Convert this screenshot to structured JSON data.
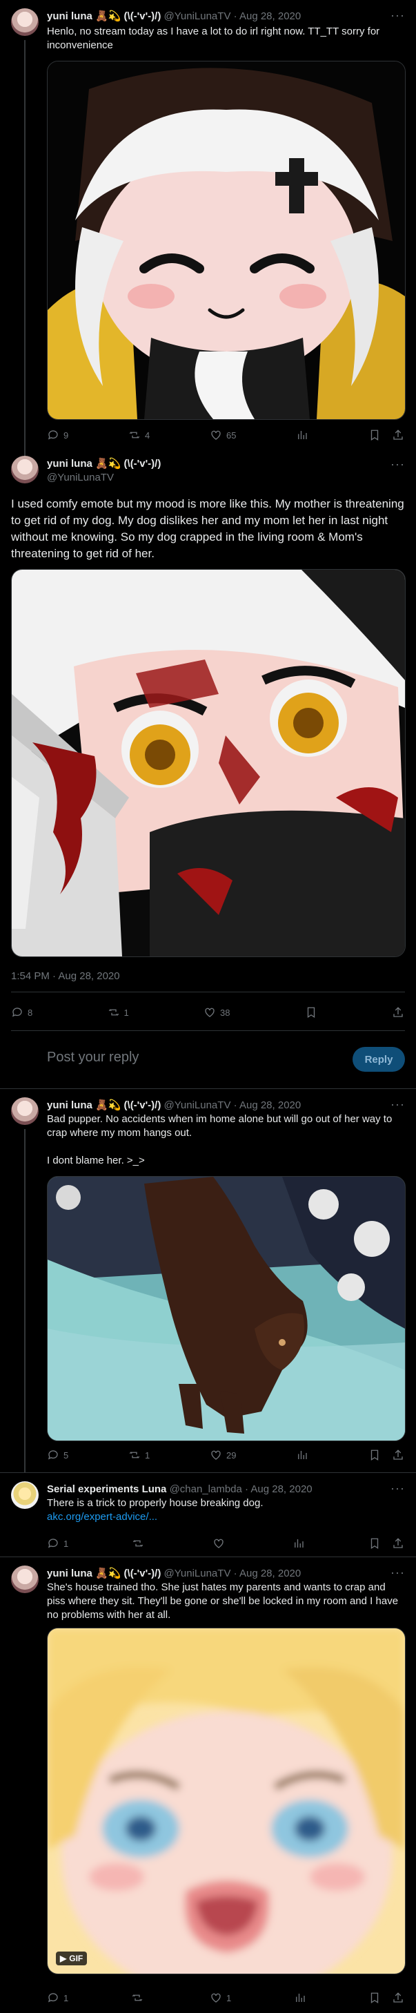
{
  "tweets": [
    {
      "name": "yuni luna 🧸💫 (\\(-'v'-)/)",
      "handle": "@YuniLunaTV",
      "date": "Aug 28, 2020",
      "text": "Henlo, no stream today as I have a lot to do irl right now. TT_TT sorry for inconvenience",
      "image_desc": "chibi-sleepy-luna",
      "replies": "9",
      "retweets": "4",
      "likes": "65"
    },
    {
      "name": "yuni luna 🧸💫 (\\(-'v'-)/)",
      "handle": "@YuniLunaTV",
      "text": "I used comfy emote but my mood is more like this. My mother is threatening to get rid of my dog. My dog dislikes her and my mom let her in last night without me knowing. So my dog crapped in the living room & Mom's threatening to get rid of her.",
      "timestamp": "1:54 PM · Aug 28, 2020",
      "replies": "8",
      "retweets": "1",
      "likes": "38"
    },
    {
      "name": "yuni luna 🧸💫 (\\(-'v'-)/)",
      "handle": "@YuniLunaTV",
      "date": "Aug 28, 2020",
      "text_1": "Bad pupper. No accidents when im home alone but will go out of her way to crap where my mom hangs out.",
      "text_2": "I dont blame her. >_>",
      "replies": "5",
      "retweets": "1",
      "likes": "29"
    },
    {
      "name": "Serial experiments Luna",
      "handle": "@chan_lambda",
      "date": "Aug 28, 2020",
      "text": "There is a trick to properly house breaking dog.",
      "link": "akc.org/expert-advice/...",
      "replies": "1",
      "retweets": "",
      "likes": ""
    },
    {
      "name": "yuni luna 🧸💫 (\\(-'v'-)/)",
      "handle": "@YuniLunaTV",
      "date": "Aug 28, 2020",
      "text": "She's house trained tho. She just hates my parents and wants to crap and piss where they sit. They'll be gone or she'll be locked in my room and I have no problems with her at all.",
      "gif_label": "GIF",
      "replies": "1",
      "retweets": "",
      "likes": "1"
    }
  ],
  "reply_box": {
    "placeholder": "Post your reply",
    "button": "Reply"
  },
  "colors": {
    "accent": "#1d9bf0",
    "background": "#000000",
    "muted": "#71767b"
  }
}
